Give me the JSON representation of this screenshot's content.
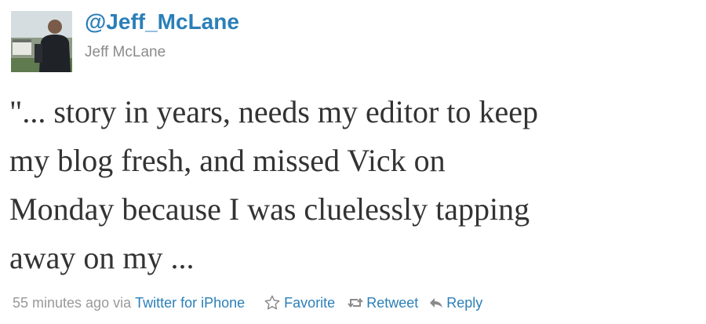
{
  "author": {
    "handle": "@Jeff_McLane",
    "name": "Jeff McLane"
  },
  "tweet": {
    "lines": [
      "\"... story in years, needs my editor to keep",
      "my blog fresh, and missed Vick on",
      "Monday because I was cluelessly tapping",
      "away on my ..."
    ]
  },
  "meta": {
    "timestamp": "55 minutes ago",
    "via": "via",
    "source": "Twitter for iPhone"
  },
  "actions": {
    "favorite": "Favorite",
    "retweet": "Retweet",
    "reply": "Reply"
  },
  "colors": {
    "link": "#2a7fb8",
    "muted": "#999999",
    "text": "#333333"
  },
  "icons": [
    "avatar-photo",
    "star-icon",
    "retweet-icon",
    "reply-icon"
  ]
}
